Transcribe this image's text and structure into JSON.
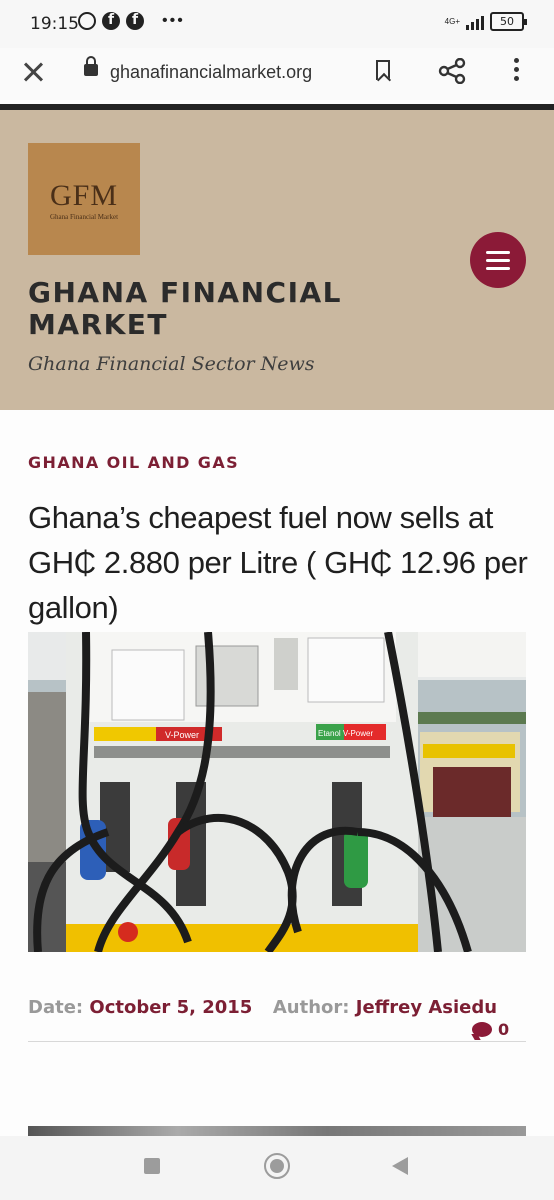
{
  "status_bar": {
    "time": "19:15",
    "network": "4G+",
    "battery": "50"
  },
  "browser": {
    "url": "ghanafinancialmarket.org"
  },
  "site": {
    "logo_text": "GFM",
    "logo_subtext": "Ghana Financial Market",
    "title": "GHANA FINANCIAL MARKET",
    "tagline": "Ghana Financial Sector News",
    "header_color": "#cab8a0",
    "accent_color": "#7c1f34"
  },
  "article": {
    "category": "GHANA OIL AND GAS",
    "headline": "Ghana’s cheapest fuel now sells at GH₵ 2.880 per Litre ( GH₵ 12.96 per gallon)",
    "image_pump_labels": [
      "V-Power",
      "Etanol V-Power"
    ],
    "date_label": "Date:",
    "date": "October 5, 2015",
    "author_label": "Author:",
    "author": "Jeffrey Asiedu",
    "comment_count": "0"
  }
}
